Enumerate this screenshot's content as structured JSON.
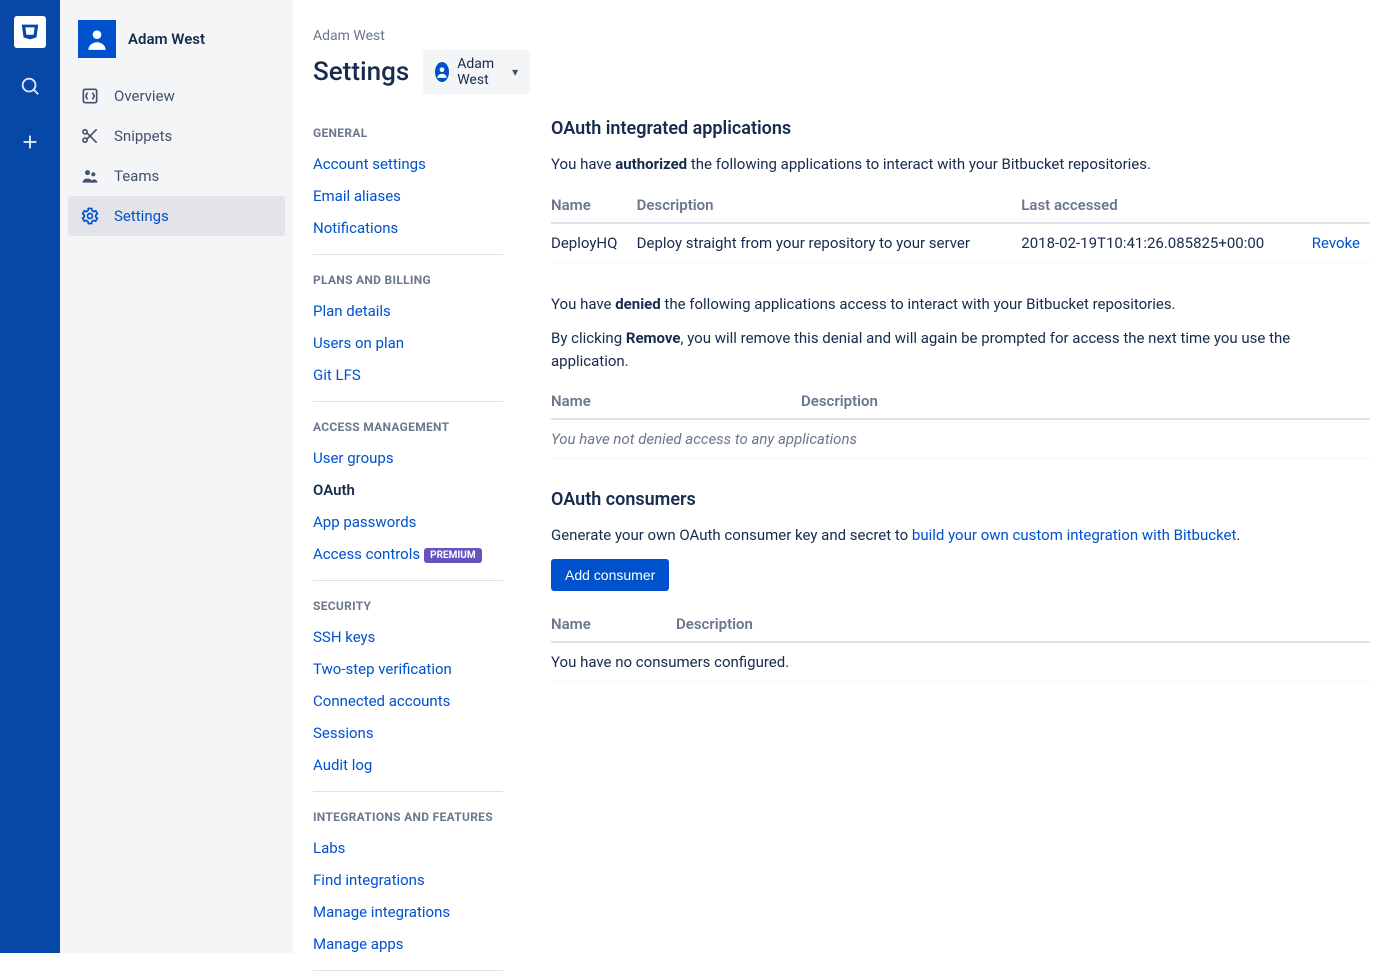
{
  "user": {
    "name": "Adam West"
  },
  "context_nav": {
    "items": [
      {
        "label": "Overview"
      },
      {
        "label": "Snippets"
      },
      {
        "label": "Teams"
      },
      {
        "label": "Settings"
      }
    ]
  },
  "breadcrumb": "Adam West",
  "page_title": "Settings",
  "switcher_name": "Adam West",
  "settings_nav": {
    "groups": [
      {
        "title": "GENERAL",
        "items": [
          {
            "label": "Account settings"
          },
          {
            "label": "Email aliases"
          },
          {
            "label": "Notifications"
          }
        ]
      },
      {
        "title": "PLANS AND BILLING",
        "items": [
          {
            "label": "Plan details"
          },
          {
            "label": "Users on plan"
          },
          {
            "label": "Git LFS"
          }
        ]
      },
      {
        "title": "ACCESS MANAGEMENT",
        "items": [
          {
            "label": "User groups"
          },
          {
            "label": "OAuth",
            "active": true
          },
          {
            "label": "App passwords"
          },
          {
            "label": "Access controls",
            "badge": "PREMIUM"
          }
        ]
      },
      {
        "title": "SECURITY",
        "items": [
          {
            "label": "SSH keys"
          },
          {
            "label": "Two-step verification"
          },
          {
            "label": "Connected accounts"
          },
          {
            "label": "Sessions"
          },
          {
            "label": "Audit log"
          }
        ]
      },
      {
        "title": "INTEGRATIONS AND FEATURES",
        "items": [
          {
            "label": "Labs"
          },
          {
            "label": "Find integrations"
          },
          {
            "label": "Manage integrations"
          },
          {
            "label": "Manage apps"
          }
        ]
      }
    ]
  },
  "oauth": {
    "integrated_title": "OAuth integrated applications",
    "authorized_text_pre": "You have ",
    "authorized_strong": "authorized",
    "authorized_text_post": " the following applications to interact with your Bitbucket repositories.",
    "authorized_cols": {
      "name": "Name",
      "description": "Description",
      "last_accessed": "Last accessed"
    },
    "authorized_rows": [
      {
        "name": "DeployHQ",
        "description": "Deploy straight from your repository to your server",
        "last_accessed": "2018-02-19T10:41:26.085825+00:00",
        "action": "Revoke"
      }
    ],
    "denied_text_pre": "You have ",
    "denied_strong": "denied",
    "denied_text_post": " the following applications access to interact with your Bitbucket repositories.",
    "remove_text_pre": "By clicking ",
    "remove_strong": "Remove",
    "remove_text_post": ", you will remove this denial and will again be prompted for access the next time you use the application.",
    "denied_cols": {
      "name": "Name",
      "description": "Description"
    },
    "denied_empty": "You have not denied access to any applications",
    "consumers_title": "OAuth consumers",
    "consumers_text_pre": "Generate your own OAuth consumer key and secret to ",
    "consumers_link": "build your own custom integration with Bitbucket",
    "consumers_text_post": ".",
    "add_consumer": "Add consumer",
    "consumers_cols": {
      "name": "Name",
      "description": "Description"
    },
    "consumers_empty": "You have no consumers configured."
  }
}
